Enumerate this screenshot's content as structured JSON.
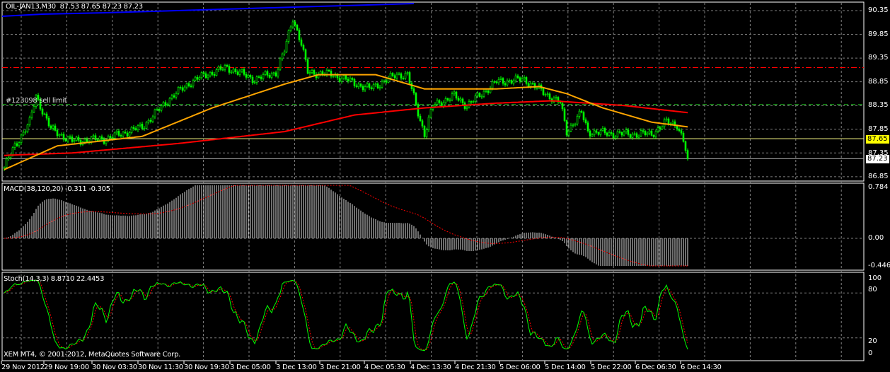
{
  "header": {
    "symbol": "OIL-JAN13,M30",
    "ohlc": "87.53 87.65 87.23 87.23"
  },
  "order_label": "#123098 sell limit",
  "price_axis": {
    "ticks": [
      "90.35",
      "89.85",
      "89.35",
      "88.85",
      "88.35",
      "87.85",
      "87.35",
      "86.85"
    ],
    "tick_values": [
      90.35,
      89.85,
      89.35,
      88.85,
      88.35,
      87.85,
      87.35,
      86.85
    ],
    "ask_tag": "87.65",
    "ask_value": 87.65,
    "bid_tag": "87.23",
    "bid_value": 87.23,
    "range": [
      86.75,
      90.5
    ]
  },
  "levels": {
    "red_line": 89.15,
    "green_sell_limit": 88.37
  },
  "macd": {
    "label": "MACD(38,120,20) -0.311 -0.305",
    "ticks": [
      "0.784",
      "0.00",
      "-0.446"
    ],
    "range": [
      -0.446,
      0.784
    ]
  },
  "stoch": {
    "label": "Stoch(14,3,3) 8.8710 22.4453",
    "ticks": [
      "100",
      "80",
      "20",
      "0"
    ]
  },
  "copyright": "XEM MT4, © 2001-2012, MetaQuotes Software Corp.",
  "time_axis": [
    "29 Nov 2012",
    "29 Nov 19:00",
    "30 Nov 03:30",
    "30 Nov 11:30",
    "30 Nov 19:30",
    "3 Dec 05:00",
    "3 Dec 13:00",
    "3 Dec 21:00",
    "4 Dec 05:30",
    "4 Dec 13:30",
    "4 Dec 21:30",
    "5 Dec 06:00",
    "5 Dec 14:00",
    "5 Dec 22:00",
    "6 Dec 06:30",
    "6 Dec 14:30"
  ],
  "colors": {
    "candle": "#00ff00",
    "ma_fast": "#ffa500",
    "ma_slow": "#ff0000",
    "grid": "#808080",
    "ask": "#ffff00",
    "macd_signal": "#ff0000",
    "stoch_main": "#00ff00",
    "stoch_signal": "#ff0000"
  },
  "chart_data": {
    "type": "line",
    "bars": 323,
    "close_keypoints": [
      [
        0,
        87.05
      ],
      [
        5,
        87.5
      ],
      [
        12,
        88.0
      ],
      [
        15,
        88.55
      ],
      [
        22,
        87.85
      ],
      [
        32,
        87.6
      ],
      [
        48,
        87.65
      ],
      [
        65,
        87.9
      ],
      [
        78,
        88.5
      ],
      [
        88,
        88.85
      ],
      [
        95,
        89.0
      ],
      [
        105,
        89.15
      ],
      [
        118,
        88.9
      ],
      [
        128,
        89.05
      ],
      [
        132,
        89.5
      ],
      [
        136,
        90.2
      ],
      [
        140,
        89.65
      ],
      [
        143,
        89.05
      ],
      [
        155,
        89.0
      ],
      [
        172,
        88.7
      ],
      [
        185,
        89.0
      ],
      [
        190,
        89.0
      ],
      [
        195,
        88.2
      ],
      [
        198,
        87.75
      ],
      [
        202,
        88.35
      ],
      [
        212,
        88.55
      ],
      [
        218,
        88.35
      ],
      [
        232,
        88.85
      ],
      [
        245,
        88.9
      ],
      [
        255,
        88.6
      ],
      [
        262,
        88.4
      ],
      [
        265,
        87.8
      ],
      [
        272,
        88.2
      ],
      [
        275,
        87.8
      ],
      [
        288,
        87.75
      ],
      [
        305,
        87.75
      ],
      [
        312,
        88.0
      ],
      [
        317,
        87.95
      ],
      [
        320,
        87.6
      ],
      [
        322,
        87.23
      ]
    ],
    "ma_fast_keypoints": [
      [
        0,
        87.0
      ],
      [
        25,
        87.5
      ],
      [
        65,
        87.7
      ],
      [
        98,
        88.3
      ],
      [
        132,
        88.8
      ],
      [
        148,
        89.0
      ],
      [
        175,
        89.0
      ],
      [
        198,
        88.7
      ],
      [
        232,
        88.7
      ],
      [
        252,
        88.75
      ],
      [
        265,
        88.6
      ],
      [
        282,
        88.3
      ],
      [
        305,
        88.0
      ],
      [
        322,
        87.9
      ]
    ],
    "ma_slow_keypoints": [
      [
        0,
        87.3
      ],
      [
        32,
        87.35
      ],
      [
        82,
        87.55
      ],
      [
        132,
        87.8
      ],
      [
        165,
        88.15
      ],
      [
        198,
        88.3
      ],
      [
        232,
        88.4
      ],
      [
        258,
        88.45
      ],
      [
        292,
        88.35
      ],
      [
        322,
        88.2
      ]
    ]
  }
}
